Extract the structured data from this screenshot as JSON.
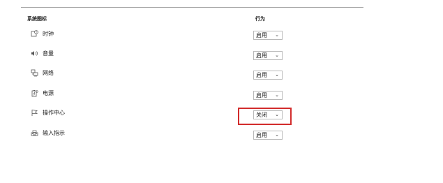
{
  "header": {
    "icons_column": "系统图标",
    "behavior_column": "行为"
  },
  "rows": [
    {
      "icon": "clock-icon",
      "label": "时钟",
      "value": "启用"
    },
    {
      "icon": "volume-icon",
      "label": "音量",
      "value": "启用"
    },
    {
      "icon": "network-icon",
      "label": "网络",
      "value": "启用"
    },
    {
      "icon": "power-icon",
      "label": "电源",
      "value": "启用"
    },
    {
      "icon": "flag-icon",
      "label": "操作中心",
      "value": "关闭"
    },
    {
      "icon": "keyboard-icon",
      "label": "输入指示",
      "value": "启用"
    }
  ],
  "chevron": "⌄",
  "highlight_color": "#d22c2c"
}
